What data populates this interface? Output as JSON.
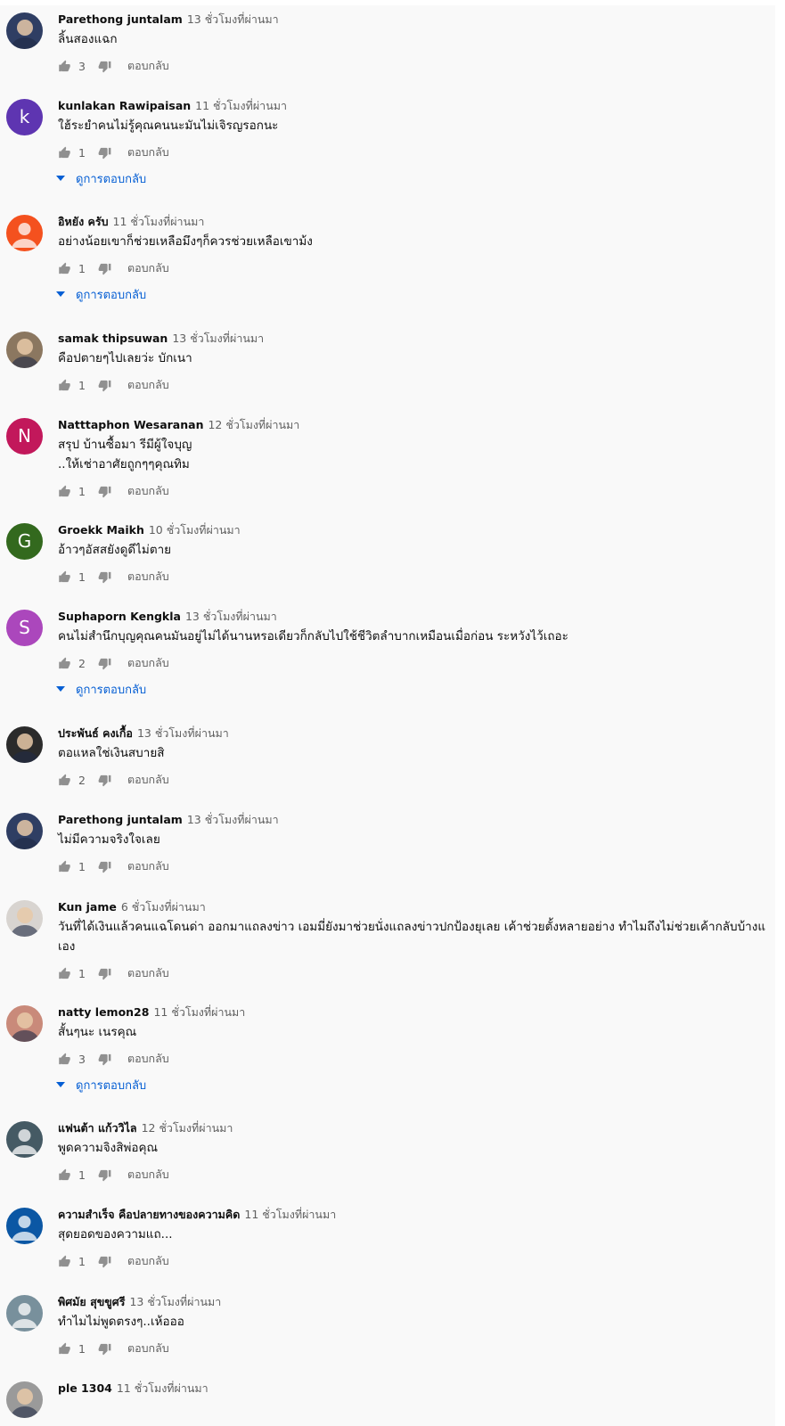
{
  "ui": {
    "reply_label": "ตอบกลับ",
    "view_replies_label": "ดูการตอบกลับ",
    "icons": {
      "like": "thumbs-up-icon",
      "dislike": "thumbs-down-icon",
      "expand": "caret-down-icon"
    },
    "colors": {
      "background": "#f9f9f9",
      "link": "#065fd4",
      "secondary_text": "#606060",
      "icon": "#909090"
    }
  },
  "comments": [
    {
      "author": "Parethong juntalam",
      "time": "13 ชั่วโมงที่ผ่านมา",
      "text": "ลิ้นสองแฉก",
      "likes": "3",
      "has_replies": false,
      "avatar": {
        "kind": "photo",
        "color": "#2f3e63"
      }
    },
    {
      "author": "kunlakan Rawipaisan",
      "time": "11 ชั่วโมงที่ผ่านมา",
      "text": "ใฮ้ระยำคนไม่รู้คุณคนนะมันไม่เจิรญรอกนะ",
      "likes": "1",
      "has_replies": true,
      "avatar": {
        "kind": "letter",
        "letter": "k",
        "color": "#5e35b1"
      }
    },
    {
      "author": "อิหยัง ครับ",
      "time": "11 ชั่วโมงที่ผ่านมา",
      "text": "อย่างน้อยเขาก็ช่วยเหลือมึงๆก็ควรช่วยเหลือเขาม้ง",
      "likes": "1",
      "has_replies": true,
      "avatar": {
        "kind": "person",
        "color": "#f4511e"
      }
    },
    {
      "author": "samak thipsuwan",
      "time": "13 ชั่วโมงที่ผ่านมา",
      "text": "คือปตายๆไปเลยว่ะ บักเนา",
      "likes": "1",
      "has_replies": false,
      "avatar": {
        "kind": "photo",
        "color": "#8b7760"
      }
    },
    {
      "author": "Natttaphon Wesaranan",
      "time": "12 ชั่วโมงที่ผ่านมา",
      "text": "สรุป บ้านซื้อมา รีมีผู้ใจบุญ\n..ให้เช่าอาศัยถูกๆๆคุณทิม",
      "likes": "1",
      "has_replies": false,
      "avatar": {
        "kind": "letter",
        "letter": "N",
        "color": "#c2185b"
      }
    },
    {
      "author": "Groekk Maikh",
      "time": "10 ชั่วโมงที่ผ่านมา",
      "text": "อ้าวๆอัสสยังดูดีไม่ตาย",
      "likes": "1",
      "has_replies": false,
      "avatar": {
        "kind": "letter",
        "letter": "G",
        "color": "#33691e"
      }
    },
    {
      "author": "Suphaporn Kengkla",
      "time": "13 ชั่วโมงที่ผ่านมา",
      "text": "คนไม่สำนึกบุญคุณคนมันอยู่ไม่ได้นานหรอเดียวก็กลับไปใช้ชีวิตลำบากเหมือนเมื่อก่อน ระหวังไว้เถอะ",
      "likes": "2",
      "has_replies": true,
      "avatar": {
        "kind": "letter",
        "letter": "S",
        "color": "#ab47bc"
      }
    },
    {
      "author": "ประพันธ์ คงเกื้อ",
      "time": "13 ชั่วโมงที่ผ่านมา",
      "text": "ตอแหลใช่เงินสบายสิ",
      "likes": "2",
      "has_replies": false,
      "avatar": {
        "kind": "photo",
        "color": "#2b2b2b"
      }
    },
    {
      "author": "Parethong juntalam",
      "time": "13 ชั่วโมงที่ผ่านมา",
      "text": "ไม่มีความจริงใจเลย",
      "likes": "1",
      "has_replies": false,
      "avatar": {
        "kind": "photo",
        "color": "#2f3e63"
      }
    },
    {
      "author": "Kun jame",
      "time": "6 ชั่วโมงที่ผ่านมา",
      "text": "วันที่ได้เงินแล้วคนแฉโดนด่า ออกมาแถลงข่าว เอมมี่ยังมาช่วยนั่งแถลงข่าวปกป้องยุเลย เค้าช่วยตั้งหลายอย่าง ทำไมถึงไม่ช่วยเค้ากลับบ้างแ\nเอง",
      "likes": "1",
      "has_replies": false,
      "avatar": {
        "kind": "photo",
        "color": "#d8d4d0"
      }
    },
    {
      "author": "natty lemon28",
      "time": "11 ชั่วโมงที่ผ่านมา",
      "text": "สั้นๆนะ เนรคุณ",
      "likes": "3",
      "has_replies": true,
      "avatar": {
        "kind": "photo",
        "color": "#c98a7a"
      }
    },
    {
      "author": "แฟนต้า แก้ววิไล",
      "time": "12 ชั่วโมงที่ผ่านมา",
      "text": "พูดความจิงสิพ่อคุณ",
      "likes": "1",
      "has_replies": false,
      "avatar": {
        "kind": "person",
        "color": "#455a64"
      }
    },
    {
      "author": "ความสำเร็จ คือปลายทางของความคิด",
      "time": "11 ชั่วโมงที่ผ่านมา",
      "text": "สุดยอดของความแถ...",
      "likes": "1",
      "has_replies": false,
      "avatar": {
        "kind": "person",
        "color": "#0b57a4"
      }
    },
    {
      "author": "พิศมัย สุขขูศรี",
      "time": "13 ชั่วโมงที่ผ่านมา",
      "text": "ทำไมไม่พูดตรงๆ..เห้อออ",
      "likes": "1",
      "has_replies": false,
      "avatar": {
        "kind": "person",
        "color": "#78909c"
      }
    },
    {
      "author": "ple 1304",
      "time": "11 ชั่วโมงที่ผ่านมา",
      "text": "",
      "likes": "",
      "has_replies": false,
      "avatar": {
        "kind": "photo",
        "color": "#9a9a9a"
      }
    }
  ]
}
